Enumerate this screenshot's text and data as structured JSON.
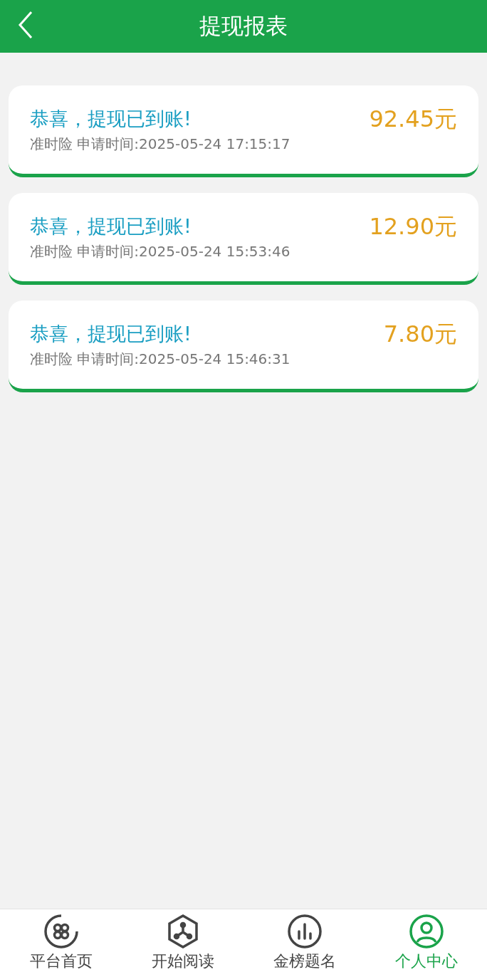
{
  "header": {
    "title": "提现报表"
  },
  "records": [
    {
      "title": "恭喜，提现已到账!",
      "detail": "准时险 申请时间:2025-05-24 17:15:17",
      "amount": "92.45元"
    },
    {
      "title": "恭喜，提现已到账!",
      "detail": "准时险 申请时间:2025-05-24 15:53:46",
      "amount": "12.90元"
    },
    {
      "title": "恭喜，提现已到账!",
      "detail": "准时险 申请时间:2025-05-24 15:46:31",
      "amount": "7.80元"
    }
  ],
  "tabs": [
    {
      "kind": "home",
      "label": "平台首页",
      "selected": false
    },
    {
      "kind": "read",
      "label": "开始阅读",
      "selected": false
    },
    {
      "kind": "rank",
      "label": "金榜题名",
      "selected": false
    },
    {
      "kind": "profile",
      "label": "个人中心",
      "selected": true
    }
  ]
}
